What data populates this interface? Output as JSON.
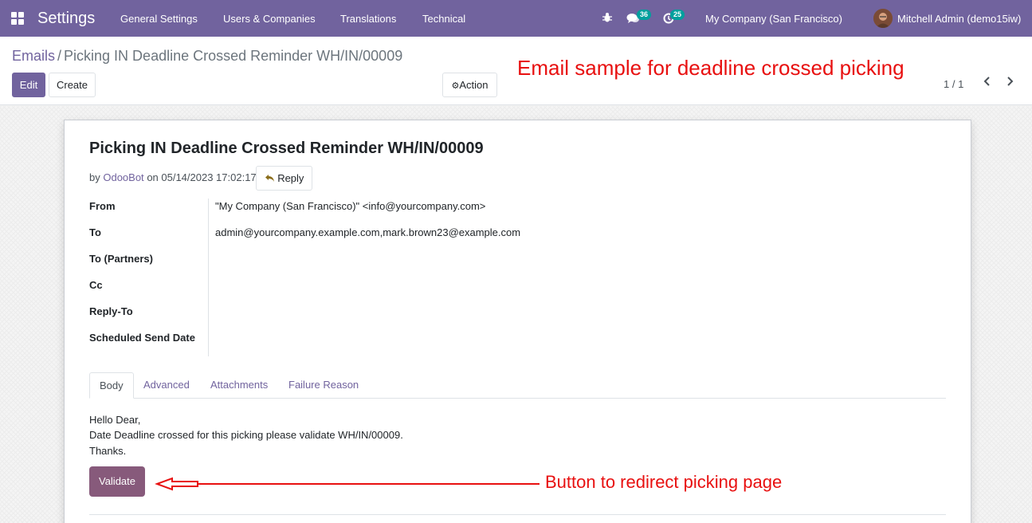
{
  "navbar": {
    "app_name": "Settings",
    "menu": [
      "General Settings",
      "Users & Companies",
      "Translations",
      "Technical"
    ],
    "messages_count": "36",
    "activities_count": "25",
    "company": "My Company (San Francisco)",
    "user": "Mitchell Admin (demo15iw)"
  },
  "breadcrumb": {
    "parent": "Emails",
    "separator": "/",
    "current": "Picking IN Deadline Crossed Reminder WH/IN/00009"
  },
  "toolbar": {
    "edit_label": "Edit",
    "create_label": "Create",
    "action_label": "Action"
  },
  "pager": {
    "value": "1 / 1"
  },
  "annotations": {
    "top": "Email sample for deadline crossed picking",
    "button": "Button to redirect picking page"
  },
  "email": {
    "subject": "Picking IN Deadline Crossed Reminder WH/IN/00009",
    "by_prefix": "by",
    "author": "OdooBot",
    "date_text": "on 05/14/2023 17:02:17",
    "reply_label": "Reply",
    "fields": [
      {
        "label": "From",
        "value": "\"My Company (San Francisco)\" <info@yourcompany.com>"
      },
      {
        "label": "To",
        "value": "admin@yourcompany.example.com,mark.brown23@example.com"
      },
      {
        "label": "To (Partners)",
        "value": ""
      },
      {
        "label": "Cc",
        "value": ""
      },
      {
        "label": "Reply-To",
        "value": ""
      },
      {
        "label": "Scheduled Send Date",
        "value": ""
      }
    ]
  },
  "tabs": [
    "Body",
    "Advanced",
    "Attachments",
    "Failure Reason"
  ],
  "body": {
    "lines": [
      "Hello Dear,",
      "Date Deadline crossed for this picking please validate WH/IN/00009.",
      "Thanks."
    ],
    "button_label": "Validate"
  },
  "colors": {
    "brand": "#71639e",
    "validate_button": "#875a7b",
    "annotation": "#e81010",
    "badge": "#00a09d"
  }
}
